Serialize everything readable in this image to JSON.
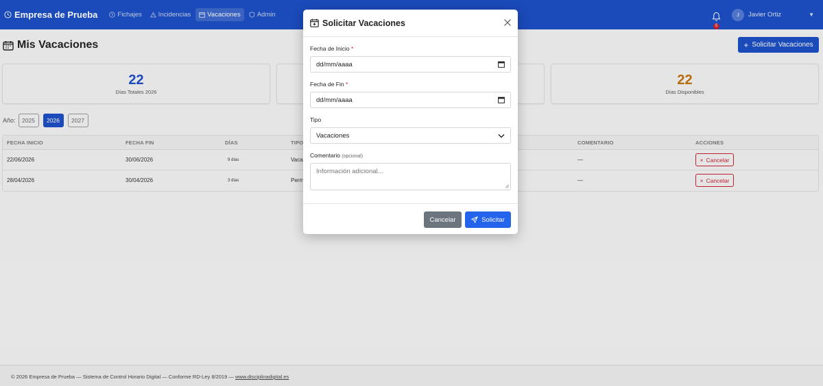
{
  "navbar": {
    "brand": "Empresa de Prueba",
    "links": [
      {
        "label": "Fichajes",
        "icon": "clock-icon"
      },
      {
        "label": "Incidencias",
        "icon": "warning-icon"
      },
      {
        "label": "Vacaciones",
        "icon": "calendar-icon",
        "active": true
      },
      {
        "label": "Admin",
        "icon": "shield-icon"
      }
    ],
    "notification_count": "5",
    "user_initial": "J",
    "user_name": "Javier Ortiz"
  },
  "page": {
    "title": "Mis Vacaciones",
    "request_button": "Solicitar Vacaciones"
  },
  "stats": [
    {
      "value": "22",
      "label": "Días Totales 2026",
      "color": "#1d4fc4"
    },
    {
      "value": "22",
      "label": "Días Disponibles",
      "color": "#c0720c"
    }
  ],
  "years": {
    "label": "Año:",
    "options": [
      "2025",
      "2026",
      "2027"
    ],
    "selected": "2026"
  },
  "table": {
    "headers": [
      "FECHA INICIO",
      "FECHA FIN",
      "DÍAS",
      "TIPO",
      "COMENTARIO",
      "ACCIONES"
    ],
    "rows": [
      {
        "start": "22/06/2026",
        "end": "30/06/2026",
        "days": "9 días",
        "type": "Vacac",
        "comment": "—",
        "action": "Cancelar"
      },
      {
        "start": "28/04/2026",
        "end": "30/04/2026",
        "days": "3 días",
        "type": "Perm",
        "comment": "—",
        "action": "Cancelar"
      }
    ]
  },
  "footer": {
    "text": "© 2026 Empresa de Prueba — Sistema de Control Horario Digital — Conforme RD-Ley 8/2019 — ",
    "link": "www.disciplinadigital.es"
  },
  "modal": {
    "title": "Solicitar Vacaciones",
    "start_label": "Fecha de Inicio",
    "start_value": "dd/mm/aaaa",
    "end_label": "Fecha de Fin",
    "end_value": "dd/mm/aaaa",
    "required_mark": "*",
    "type_label": "Tipo",
    "type_value": "Vacaciones",
    "comment_label": "Comentario",
    "comment_optional": "(opcional)",
    "comment_placeholder": "Información adicional...",
    "cancel_button": "Cancelar",
    "submit_button": "Solicitar"
  }
}
